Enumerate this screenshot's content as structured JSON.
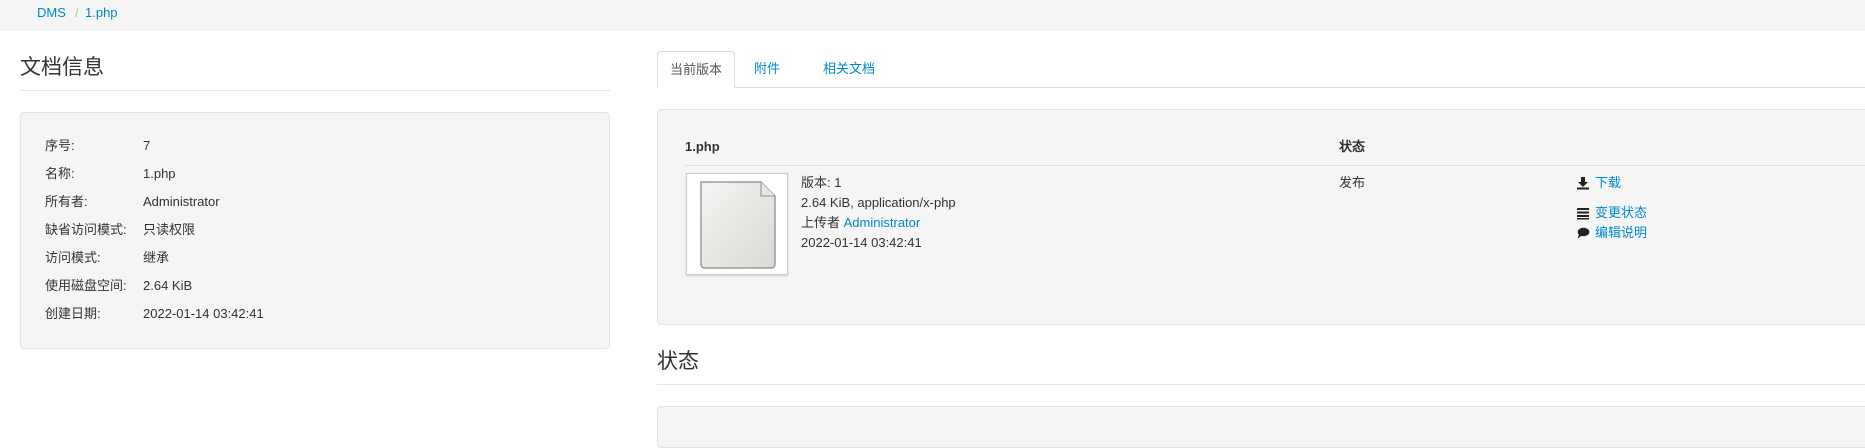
{
  "breadcrumb": {
    "items": [
      "DMS",
      "1.php"
    ],
    "separator": "/"
  },
  "doc_info": {
    "heading": "文档信息",
    "rows": [
      {
        "label": "序号:",
        "value": "7"
      },
      {
        "label": "名称:",
        "value": "1.php"
      },
      {
        "label": "所有者:",
        "value": "Administrator",
        "link": true
      },
      {
        "label": "缺省访问模式:",
        "value": "只读权限"
      },
      {
        "label": "访问模式:",
        "value": "继承"
      },
      {
        "label": "使用磁盘空间:",
        "value": "2.64 KiB"
      },
      {
        "label": "创建日期:",
        "value": "2022-01-14 03:42:41"
      }
    ]
  },
  "tabs": {
    "items": [
      "当前版本",
      "附件",
      "相关文档"
    ],
    "active": "当前版本"
  },
  "version": {
    "col_name": "1.php",
    "col_status": "状态",
    "version_line": "版本: 1",
    "size_line": "2.64 KiB, application/x-php",
    "uploader_prefix": "上传者",
    "uploader": "Administrator",
    "date": "2022-01-14 03:42:41",
    "status": "发布",
    "actions": {
      "download": "下载",
      "change_status": "变更状态",
      "edit_comment": "编辑说明"
    },
    "icons": {
      "download": "download-icon",
      "change_status": "list-icon",
      "edit_comment": "comment-icon",
      "file": "file-icon"
    }
  },
  "status_section": {
    "heading": "状态"
  },
  "colors": {
    "link": "#0088cc",
    "well_bg": "#f5f5f5",
    "border": "#e3e3e3"
  }
}
